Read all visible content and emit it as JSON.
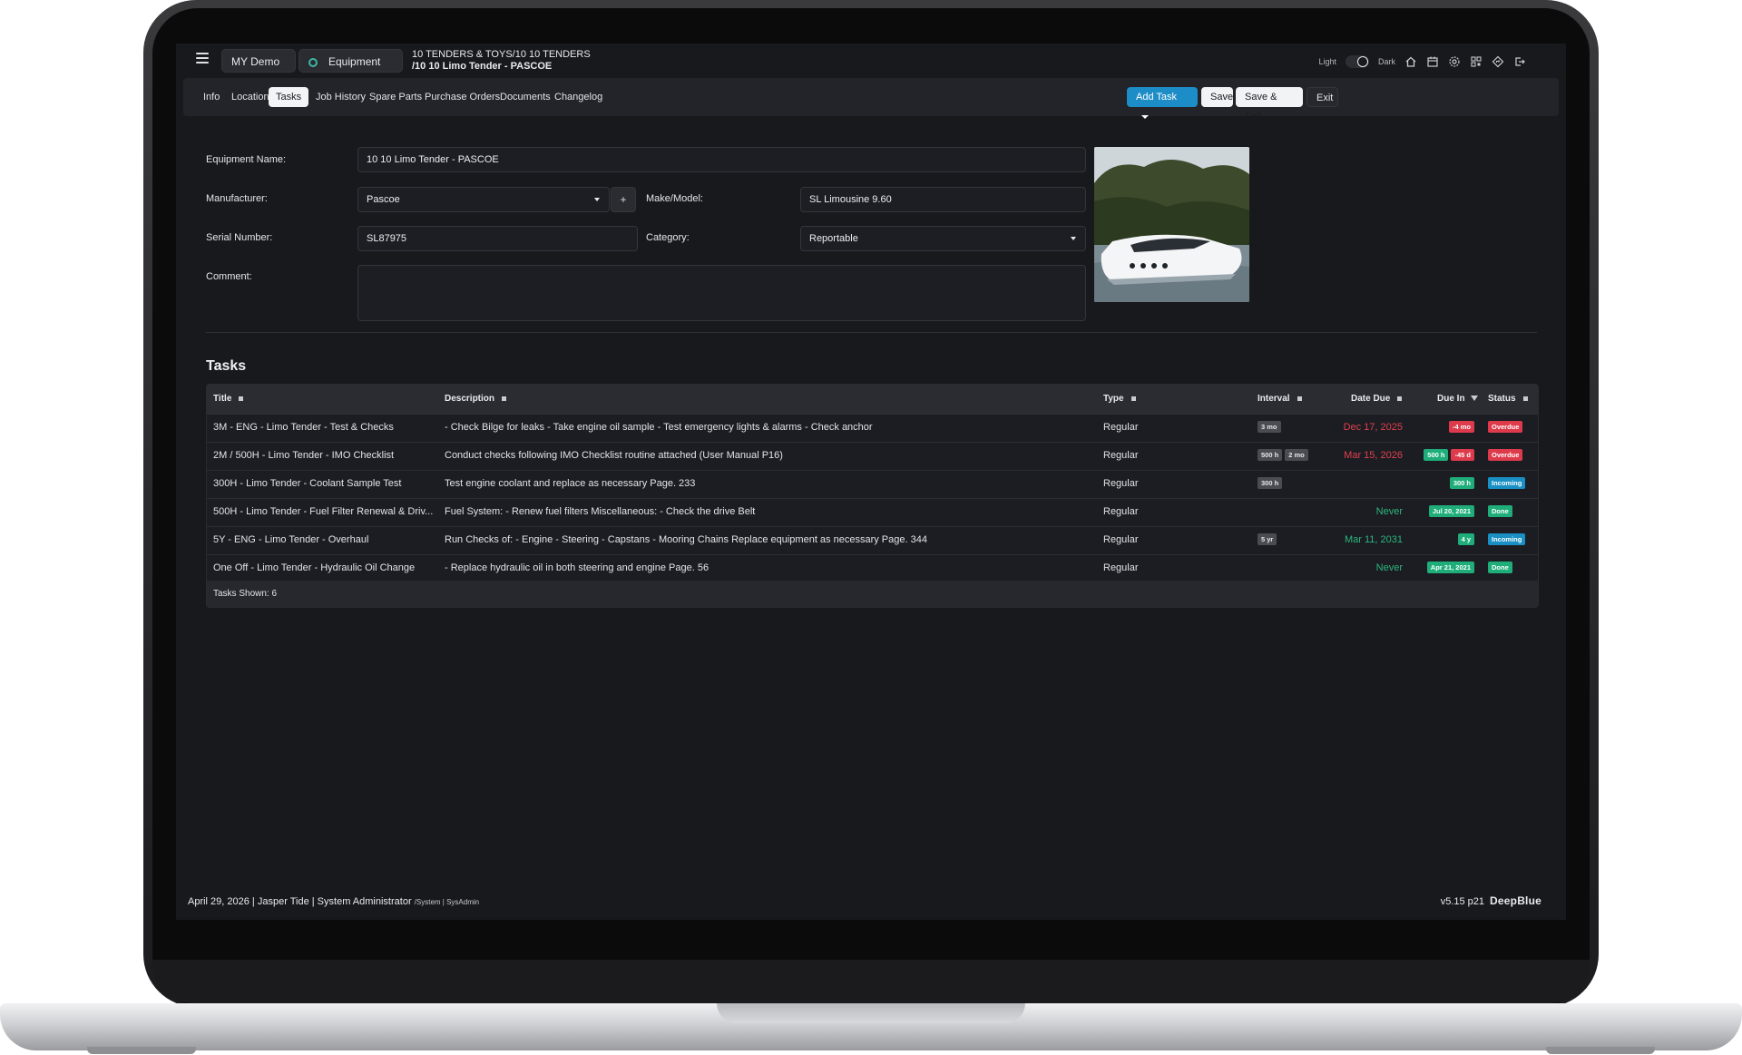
{
  "topbar": {
    "workspace": "MY Demo",
    "module": "Equipment",
    "breadcrumb_line1": "10 TENDERS & TOYS/10 10 TENDERS",
    "breadcrumb_line2": "/10 10 Limo Tender - PASCOE",
    "theme_light": "Light",
    "theme_dark": "Dark"
  },
  "tabs": [
    "Info",
    "Location",
    "Tasks",
    "Job History",
    "Spare Parts",
    "Purchase Orders",
    "Documents",
    "Changelog"
  ],
  "active_tab": "Tasks",
  "actions": {
    "add_task": "Add Task",
    "save": "Save",
    "save_exit": "Save & Exit",
    "exit": "Exit"
  },
  "form": {
    "equipment_name_label": "Equipment Name:",
    "equipment_name": "10 10 Limo Tender - PASCOE",
    "manufacturer_label": "Manufacturer:",
    "manufacturer": "Pascoe",
    "add_symbol": "+",
    "make_model_label": "Make/Model:",
    "make_model": "SL Limousine 9.60",
    "serial_label": "Serial Number:",
    "serial": "SL87975",
    "category_label": "Category:",
    "category": "Reportable",
    "comment_label": "Comment:",
    "comment": ""
  },
  "tasks": {
    "heading": "Tasks",
    "columns": {
      "title": "Title",
      "description": "Description",
      "type": "Type",
      "interval": "Interval",
      "date_due": "Date Due",
      "due_in": "Due In",
      "status": "Status"
    },
    "rows": [
      {
        "title": "3M - ENG - Limo Tender - Test & Checks",
        "description": "- Check Bilge for leaks - Take engine oil sample - Test emergency lights & alarms - Check anchor",
        "type": "Regular",
        "interval": [
          "3 mo"
        ],
        "date_due": "Dec 17, 2025",
        "date_color": "red",
        "due_in": [
          {
            "text": "-4 mo",
            "color": "red"
          }
        ],
        "status": "Overdue",
        "status_color": "red"
      },
      {
        "title": "2M / 500H - Limo Tender - IMO Checklist",
        "description": "Conduct checks following IMO Checklist routine attached (User Manual P16)",
        "type": "Regular",
        "interval": [
          "500 h",
          "2 mo"
        ],
        "date_due": "Mar 15, 2026",
        "date_color": "red",
        "due_in": [
          {
            "text": "500 h",
            "color": "green"
          },
          {
            "text": "-45 d",
            "color": "red"
          }
        ],
        "status": "Overdue",
        "status_color": "red"
      },
      {
        "title": "300H - Limo Tender - Coolant Sample Test",
        "description": "Test engine coolant and replace as necessary Page. 233",
        "type": "Regular",
        "interval": [
          "300 h"
        ],
        "date_due": "",
        "date_color": "red",
        "due_in": [
          {
            "text": "300 h",
            "color": "green"
          }
        ],
        "status": "Incoming",
        "status_color": "blue"
      },
      {
        "title": "500H - Limo Tender - Fuel Filter Renewal & Driv...",
        "description": "Fuel System: - Renew fuel filters Miscellaneous: - Check the drive Belt",
        "type": "Regular",
        "interval": [],
        "date_due": "Never",
        "date_color": "green",
        "due_in": [
          {
            "text": "Jul 20, 2021",
            "color": "green"
          }
        ],
        "status": "Done",
        "status_color": "green"
      },
      {
        "title": "5Y - ENG - Limo Tender - Overhaul",
        "description": "Run Checks of: - Engine - Steering - Capstans - Mooring Chains Replace equipment as necessary Page. 344",
        "type": "Regular",
        "interval": [
          "5 yr"
        ],
        "date_due": "Mar 11, 2031",
        "date_color": "green",
        "due_in": [
          {
            "text": "4 y",
            "color": "green"
          }
        ],
        "status": "Incoming",
        "status_color": "blue"
      },
      {
        "title": "One Off - Limo Tender - Hydraulic Oil Change",
        "description": "- Replace hydraulic oil in both steering and engine Page. 56",
        "type": "Regular",
        "interval": [],
        "date_due": "Never",
        "date_color": "green",
        "due_in": [
          {
            "text": "Apr 21, 2021",
            "color": "green"
          }
        ],
        "status": "Done",
        "status_color": "green"
      }
    ],
    "shown": "Tasks Shown: 6"
  },
  "footer": {
    "left": "April 29, 2026 | Jasper Tide | System Administrator",
    "left_small": "/System | SysAdmin",
    "version": "v5.15 p21",
    "brand": "DeepBlue"
  }
}
